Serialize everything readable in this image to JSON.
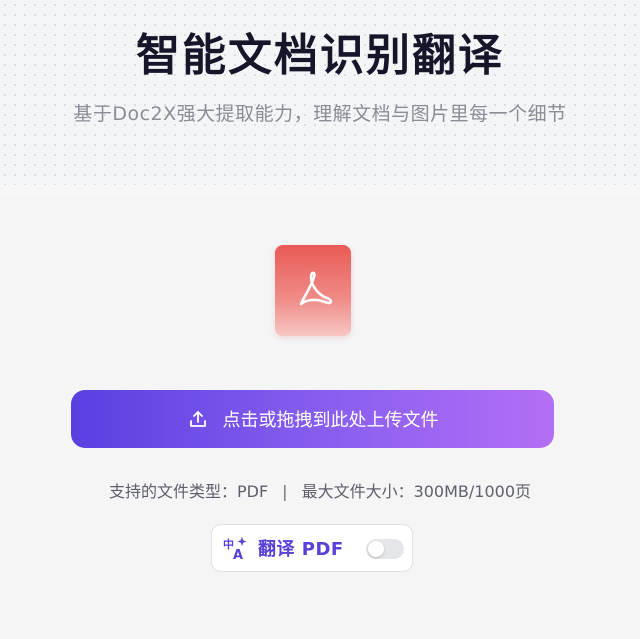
{
  "hero": {
    "title": "智能文档识别翻译",
    "subtitle": "基于Doc2X强大提取能力，理解文档与图片里每一个细节"
  },
  "upload": {
    "file_icon": "pdf-icon",
    "button_icon": "upload-icon",
    "button_label": "点击或拖拽到此处上传文件",
    "supported_types": "支持的文件类型：PDF",
    "separator": "|",
    "max_size": "最大文件大小：300MB/1000页"
  },
  "translate": {
    "icon": "translate-icon",
    "label": "翻译 PDF",
    "enabled": false
  },
  "colors": {
    "title": "#15162a",
    "accent": "#5b3fd8",
    "button_gradient_start": "#5a3fe0",
    "button_gradient_end": "#b46ef5",
    "pdf_red": "#e95a55"
  }
}
